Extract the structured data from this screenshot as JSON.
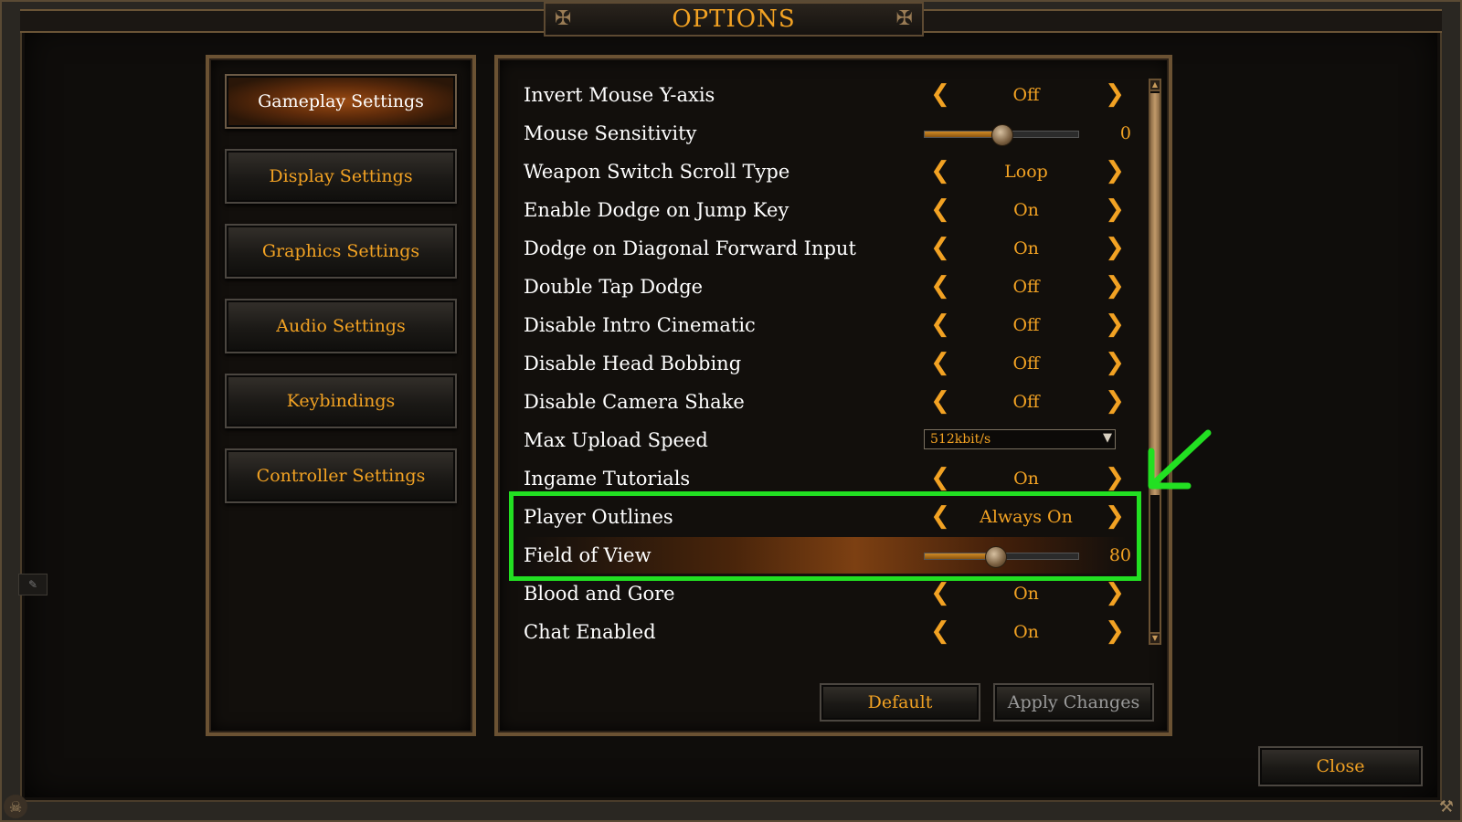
{
  "window": {
    "title": "OPTIONS"
  },
  "nav": {
    "items": [
      {
        "label": "Gameplay Settings",
        "active": true
      },
      {
        "label": "Display Settings",
        "active": false
      },
      {
        "label": "Graphics Settings",
        "active": false
      },
      {
        "label": "Audio Settings",
        "active": false
      },
      {
        "label": "Keybindings",
        "active": false
      },
      {
        "label": "Controller Settings",
        "active": false
      }
    ]
  },
  "settings": [
    {
      "label": "Invert Mouse Y-axis",
      "type": "toggle",
      "value": "Off"
    },
    {
      "label": "Mouse Sensitivity",
      "type": "slider",
      "value": "0",
      "fraction": 0.5
    },
    {
      "label": "Weapon Switch Scroll Type",
      "type": "toggle",
      "value": "Loop"
    },
    {
      "label": "Enable Dodge on Jump Key",
      "type": "toggle",
      "value": "On"
    },
    {
      "label": "Dodge on Diagonal Forward Input",
      "type": "toggle",
      "value": "On"
    },
    {
      "label": "Double Tap Dodge",
      "type": "toggle",
      "value": "Off"
    },
    {
      "label": "Disable Intro Cinematic",
      "type": "toggle",
      "value": "Off"
    },
    {
      "label": "Disable Head Bobbing",
      "type": "toggle",
      "value": "Off"
    },
    {
      "label": "Disable Camera Shake",
      "type": "toggle",
      "value": "Off"
    },
    {
      "label": "Max Upload Speed",
      "type": "dropdown",
      "value": "512kbit/s"
    },
    {
      "label": "Ingame Tutorials",
      "type": "toggle",
      "value": "On"
    },
    {
      "label": "Player Outlines",
      "type": "toggle",
      "value": "Always On"
    },
    {
      "label": "Field of View",
      "type": "slider",
      "value": "80",
      "fraction": 0.46
    },
    {
      "label": "Blood and Gore",
      "type": "toggle",
      "value": "On"
    },
    {
      "label": "Chat Enabled",
      "type": "toggle",
      "value": "On"
    }
  ],
  "footer": {
    "default_label": "Default",
    "apply_label": "Apply Changes",
    "close_label": "Close"
  },
  "icons": {
    "arrow_left": "chevron-left-icon",
    "arrow_right": "chevron-right-icon",
    "dropdown": "chevron-down-icon",
    "corner_left": "skull-icon",
    "corner_right": "tool-icon"
  },
  "colors": {
    "accent": "#f2a223",
    "annotation": "#22e022",
    "label": "#ffffff",
    "disabled": "#9a9a9a"
  },
  "annotation": {
    "highlighted_settings": [
      "Player Outlines",
      "Field of View"
    ]
  }
}
